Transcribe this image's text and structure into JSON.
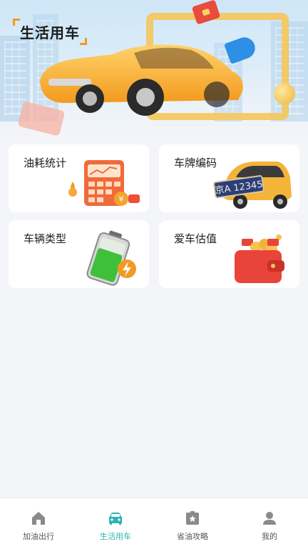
{
  "header": {
    "title": "生活用车"
  },
  "cards": [
    {
      "label": "油耗统计",
      "icon": "fuel-calculator-icon"
    },
    {
      "label": "车牌编码",
      "icon": "license-plate-car-icon",
      "plate_text": "京A 12345"
    },
    {
      "label": "车辆类型",
      "icon": "battery-icon"
    },
    {
      "label": "爱车估值",
      "icon": "wallet-icon"
    }
  ],
  "tabbar": {
    "items": [
      {
        "label": "加油出行",
        "icon": "home-icon",
        "active": false
      },
      {
        "label": "生活用车",
        "icon": "car-icon",
        "active": true
      },
      {
        "label": "省油攻略",
        "icon": "star-box-icon",
        "active": false
      },
      {
        "label": "我的",
        "icon": "user-icon",
        "active": false
      }
    ]
  },
  "colors": {
    "accent": "#2fb3b1",
    "inactive": "#8a8a8a",
    "background": "#f4f5f9",
    "card": "#ffffff",
    "title_bracket": "#f19a1f"
  }
}
